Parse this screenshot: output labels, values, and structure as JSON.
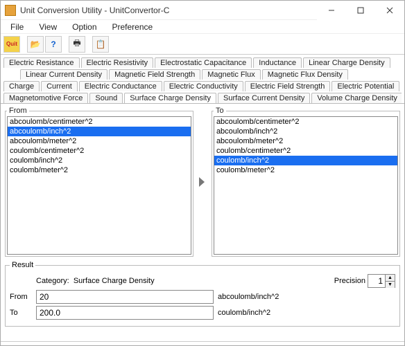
{
  "window": {
    "title": "Unit Conversion Utility - UnitConvertor-C"
  },
  "menubar": {
    "items": [
      "File",
      "View",
      "Option",
      "Preference"
    ]
  },
  "toolbar": {
    "buttons": [
      {
        "name": "quit-button",
        "label": "Quit"
      },
      {
        "name": "open-button",
        "icon": "📂"
      },
      {
        "name": "help-button",
        "icon": "?"
      },
      {
        "name": "print-button",
        "icon": "🖶"
      },
      {
        "name": "copy-button",
        "icon": "📋"
      }
    ]
  },
  "tabs": {
    "row1": [
      "Electric Resistance",
      "Electric Resistivity",
      "Electrostatic Capacitance",
      "Inductance",
      "Linear Charge Density"
    ],
    "row2": [
      "Linear Current Density",
      "Magnetic Field Strength",
      "Magnetic Flux",
      "Magnetic Flux Density"
    ],
    "row3": [
      "Charge",
      "Current",
      "Electric Conductance",
      "Electric Conductivity",
      "Electric Field Strength",
      "Electric Potential"
    ],
    "row4": [
      "Magnetomotive Force",
      "Sound",
      "Surface Charge Density",
      "Surface Current Density",
      "Volume Charge Density"
    ],
    "active": "Surface Charge Density"
  },
  "from": {
    "legend": "From",
    "items": [
      "abcoulomb/centimeter^2",
      "abcoulomb/inch^2",
      "abcoulomb/meter^2",
      "coulomb/centimeter^2",
      "coulomb/inch^2",
      "coulomb/meter^2"
    ],
    "selected": "abcoulomb/inch^2"
  },
  "to": {
    "legend": "To",
    "items": [
      "abcoulomb/centimeter^2",
      "abcoulomb/inch^2",
      "abcoulomb/meter^2",
      "coulomb/centimeter^2",
      "coulomb/inch^2",
      "coulomb/meter^2"
    ],
    "selected": "coulomb/inch^2"
  },
  "result": {
    "legend": "Result",
    "category_label": "Category:",
    "category_value": "Surface Charge Density",
    "precision_label": "Precision",
    "precision_value": "1",
    "from_label": "From",
    "from_value": "20",
    "from_unit": "abcoulomb/inch^2",
    "to_label": "To",
    "to_value": "200.0",
    "to_unit": "coulomb/inch^2"
  }
}
